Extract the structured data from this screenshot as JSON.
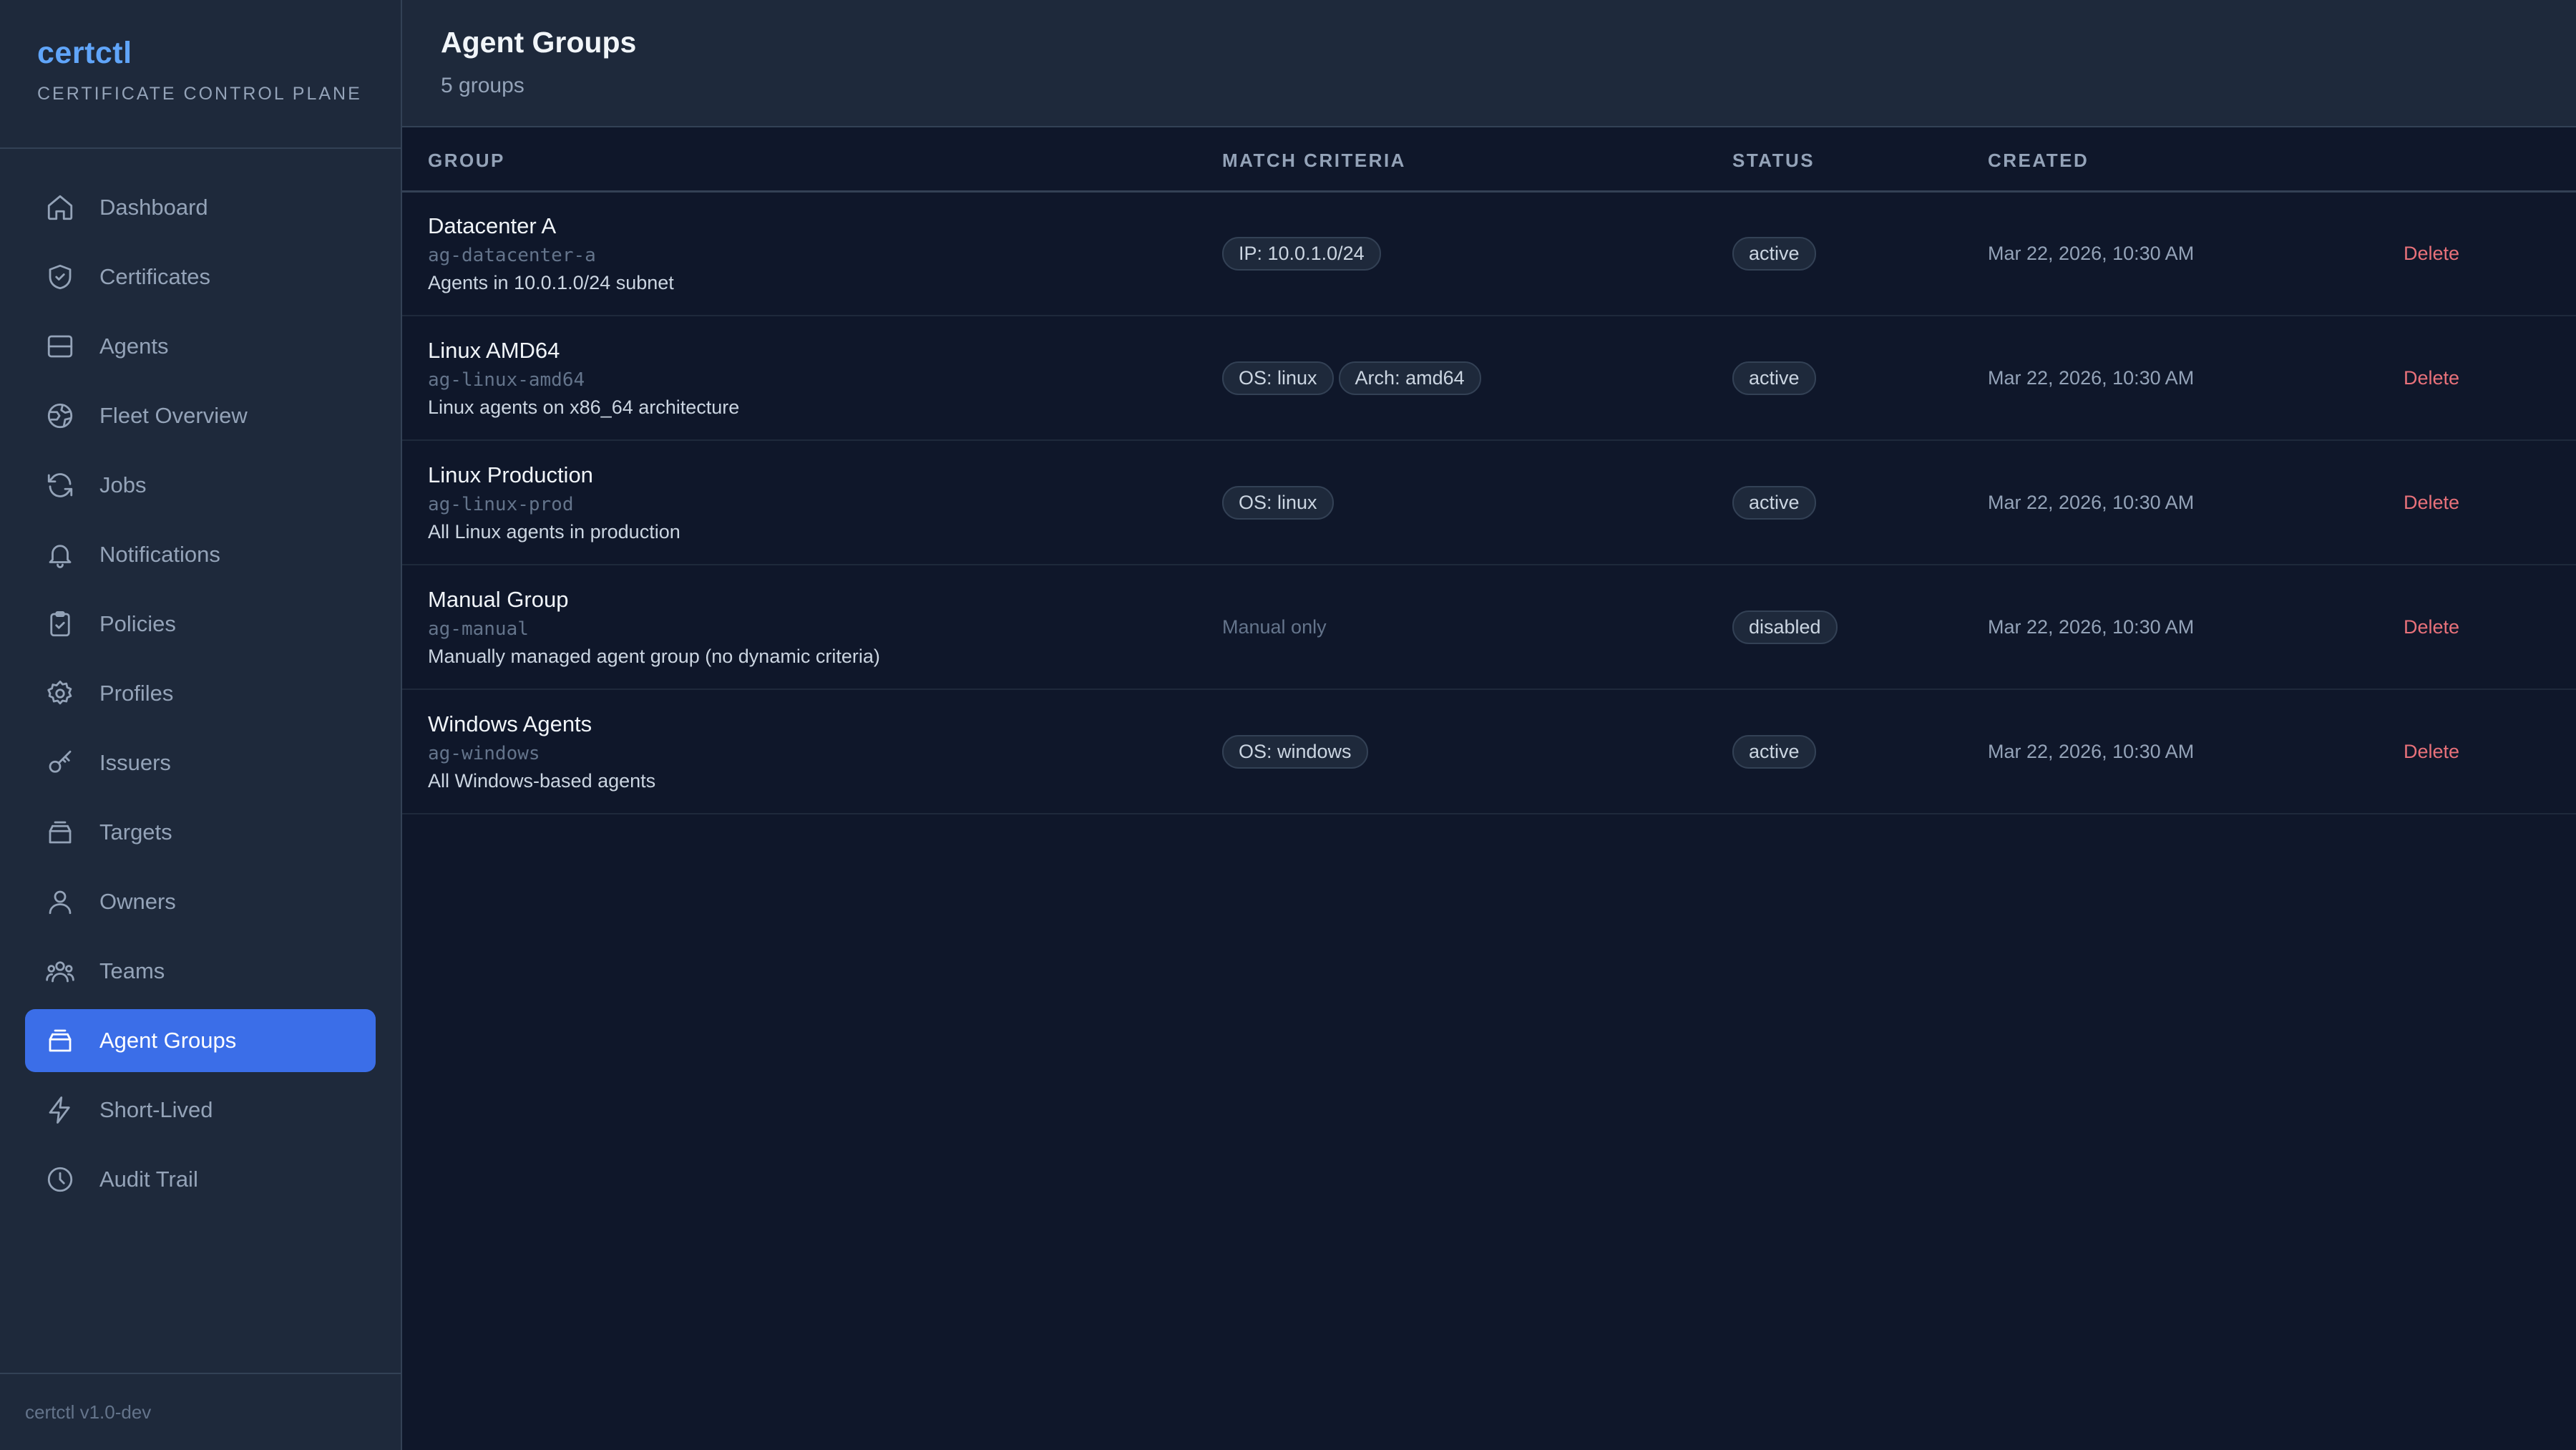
{
  "brand": {
    "name": "certctl",
    "subtitle": "CERTIFICATE CONTROL PLANE"
  },
  "sidebar": {
    "items": [
      {
        "label": "Dashboard",
        "icon": "home-icon"
      },
      {
        "label": "Certificates",
        "icon": "shield-icon"
      },
      {
        "label": "Agents",
        "icon": "server-icon"
      },
      {
        "label": "Fleet Overview",
        "icon": "globe-icon"
      },
      {
        "label": "Jobs",
        "icon": "refresh-icon"
      },
      {
        "label": "Notifications",
        "icon": "bell-icon"
      },
      {
        "label": "Policies",
        "icon": "clipboard-check-icon"
      },
      {
        "label": "Profiles",
        "icon": "gear-icon"
      },
      {
        "label": "Issuers",
        "icon": "key-icon"
      },
      {
        "label": "Targets",
        "icon": "stack-icon"
      },
      {
        "label": "Owners",
        "icon": "user-icon"
      },
      {
        "label": "Teams",
        "icon": "users-icon"
      },
      {
        "label": "Agent Groups",
        "icon": "stack-icon",
        "active": true
      },
      {
        "label": "Short-Lived",
        "icon": "bolt-icon"
      },
      {
        "label": "Audit Trail",
        "icon": "clock-icon"
      }
    ],
    "version": "certctl v1.0-dev"
  },
  "header": {
    "title": "Agent Groups",
    "subtitle": "5 groups"
  },
  "table": {
    "columns": [
      "Group",
      "Match Criteria",
      "Status",
      "Created",
      ""
    ],
    "rows": [
      {
        "name": "Datacenter A",
        "id": "ag-datacenter-a",
        "description": "Agents in 10.0.1.0/24 subnet",
        "criteria": [
          "IP: 10.0.1.0/24"
        ],
        "status": "active",
        "created": "Mar 22, 2026, 10:30 AM",
        "action": "Delete"
      },
      {
        "name": "Linux AMD64",
        "id": "ag-linux-amd64",
        "description": "Linux agents on x86_64 architecture",
        "criteria": [
          "OS: linux",
          "Arch: amd64"
        ],
        "status": "active",
        "created": "Mar 22, 2026, 10:30 AM",
        "action": "Delete"
      },
      {
        "name": "Linux Production",
        "id": "ag-linux-prod",
        "description": "All Linux agents in production",
        "criteria": [
          "OS: linux"
        ],
        "status": "active",
        "created": "Mar 22, 2026, 10:30 AM",
        "action": "Delete"
      },
      {
        "name": "Manual Group",
        "id": "ag-manual",
        "description": "Manually managed agent group (no dynamic criteria)",
        "criteria": [],
        "criteria_text": "Manual only",
        "status": "disabled",
        "created": "Mar 22, 2026, 10:30 AM",
        "action": "Delete"
      },
      {
        "name": "Windows Agents",
        "id": "ag-windows",
        "description": "All Windows-based agents",
        "criteria": [
          "OS: windows"
        ],
        "status": "active",
        "created": "Mar 22, 2026, 10:30 AM",
        "action": "Delete"
      }
    ]
  },
  "colors": {
    "accent": "#3b6ee8",
    "brand": "#60a5fa",
    "danger": "#e8717a",
    "background": "#0f172a",
    "panel": "#1e293b"
  }
}
